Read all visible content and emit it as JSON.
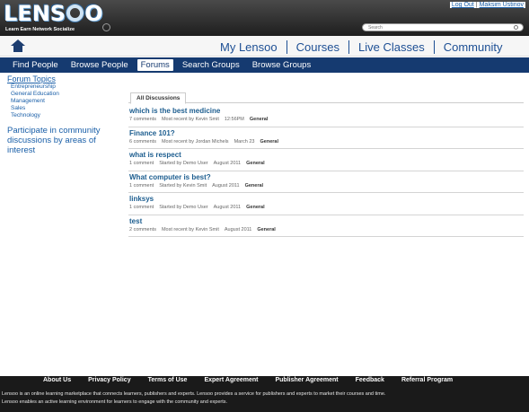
{
  "brand": {
    "logo_text_pre": "LENS",
    "logo_text_post": "O",
    "tagline": "Learn Earn Network Socialize"
  },
  "account": {
    "logout": "Log Out",
    "user": "Maksim Ustinov"
  },
  "search": {
    "placeholder": "Search"
  },
  "main_nav": {
    "items": [
      "My Lensoo",
      "Courses",
      "Live Classes",
      "Community"
    ]
  },
  "sub_nav": {
    "items": [
      "Find People",
      "Browse People",
      "Forums",
      "Search Groups",
      "Browse Groups"
    ],
    "active": "Forums"
  },
  "sidebar": {
    "title": "Forum Topics",
    "topics": [
      "Entrepreneurship",
      "General Education",
      "Management",
      "Sales",
      "Technology"
    ],
    "promo": "Participate in community discussions by areas of interest"
  },
  "discussions": {
    "tab": "All Discussions",
    "rows": [
      {
        "title": "which is the best medicine",
        "comments": "7 comments",
        "activity": "Most recent by Kevin Smit",
        "time": "12:56PM",
        "category": "General"
      },
      {
        "title": "Finance 101?",
        "comments": "6 comments",
        "activity": "Most recent by Jordan Michels",
        "time": "March 23",
        "category": "General"
      },
      {
        "title": "what is respect",
        "comments": "1 comment",
        "activity": "Started by Demo User",
        "time": "August 2011",
        "category": "General"
      },
      {
        "title": "What computer is best?",
        "comments": "1 comment",
        "activity": "Started by Kevin Smit",
        "time": "August 2011",
        "category": "General"
      },
      {
        "title": "linksys",
        "comments": "1 comment",
        "activity": "Started by Demo User",
        "time": "August 2011",
        "category": "General"
      },
      {
        "title": "test",
        "comments": "2 comments",
        "activity": "Most recent by Kevin Smit",
        "time": "August 2011",
        "category": "General"
      }
    ]
  },
  "footer": {
    "links": [
      "About Us",
      "Privacy Policy",
      "Terms of Use",
      "Expert Agreement",
      "Publisher Agreement",
      "Feedback",
      "Referral Program"
    ],
    "line1": "Lensoo is an online learning marketplace that connects learners, publishers and experts. Lensoo provides a service for publishers and experts to market their courses and time.",
    "line2": "Lensoo enables an active learning environment for learners to engage with the community and experts."
  },
  "colors": {
    "header_dark": "#1e1e1e",
    "subnav_blue": "#153a70",
    "link_blue": "#1a5fa8",
    "title_blue": "#1c5d8f"
  }
}
